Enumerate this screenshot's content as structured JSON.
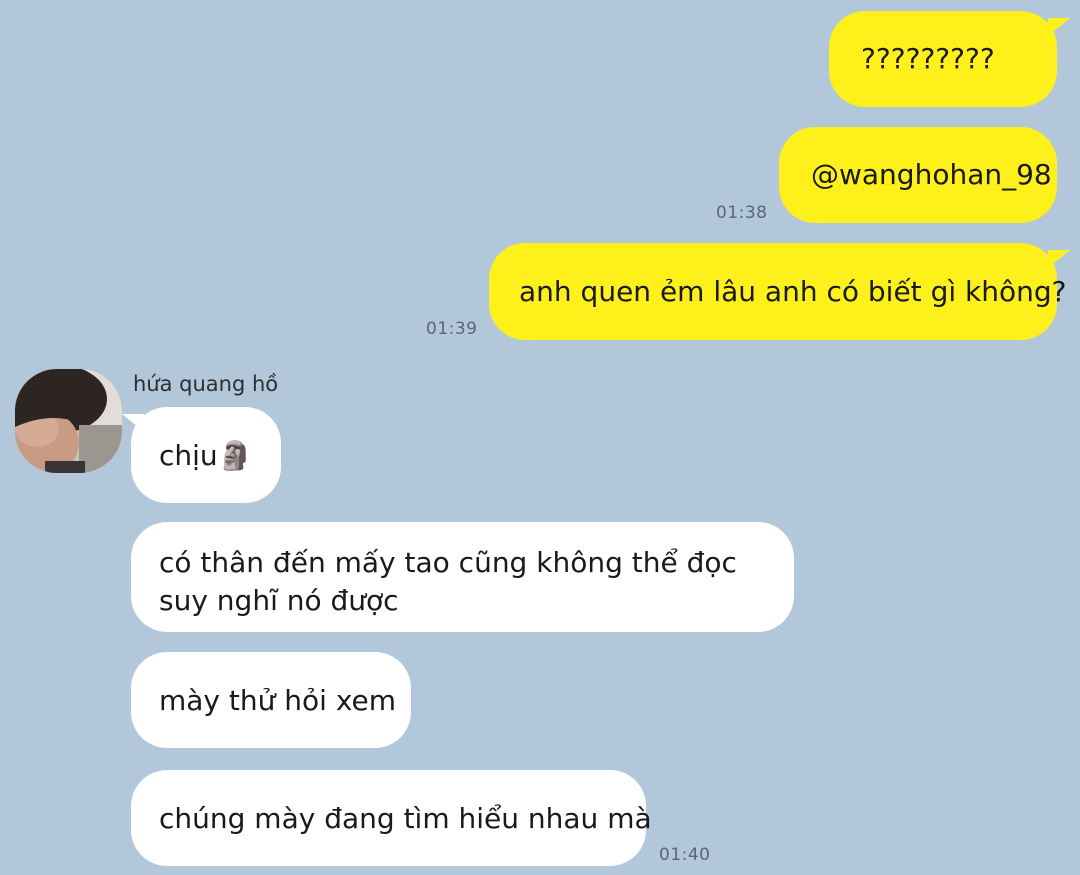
{
  "chat": {
    "outgoing": [
      {
        "text": "?????????"
      },
      {
        "text": "@wanghohan_98",
        "time": "01:38"
      },
      {
        "text": "anh quen ẻm lâu anh có biết gì không?",
        "time": "01:39"
      }
    ],
    "contact": {
      "name": "hứa quang hồ",
      "avatar_icon": "profile-photo"
    },
    "incoming": [
      {
        "text": "chịu🗿"
      },
      {
        "text": "có thân đến mấy tao cũng không thể đọc suy nghĩ nó được"
      },
      {
        "text": "mày thử hỏi xem"
      },
      {
        "text": "chúng mày đang tìm hiểu nhau mà",
        "time": "01:40"
      }
    ]
  },
  "colors": {
    "background": "#b2c7da",
    "outgoing_bubble": "#fef01b",
    "incoming_bubble": "#ffffff",
    "timestamp": "#56677a"
  }
}
